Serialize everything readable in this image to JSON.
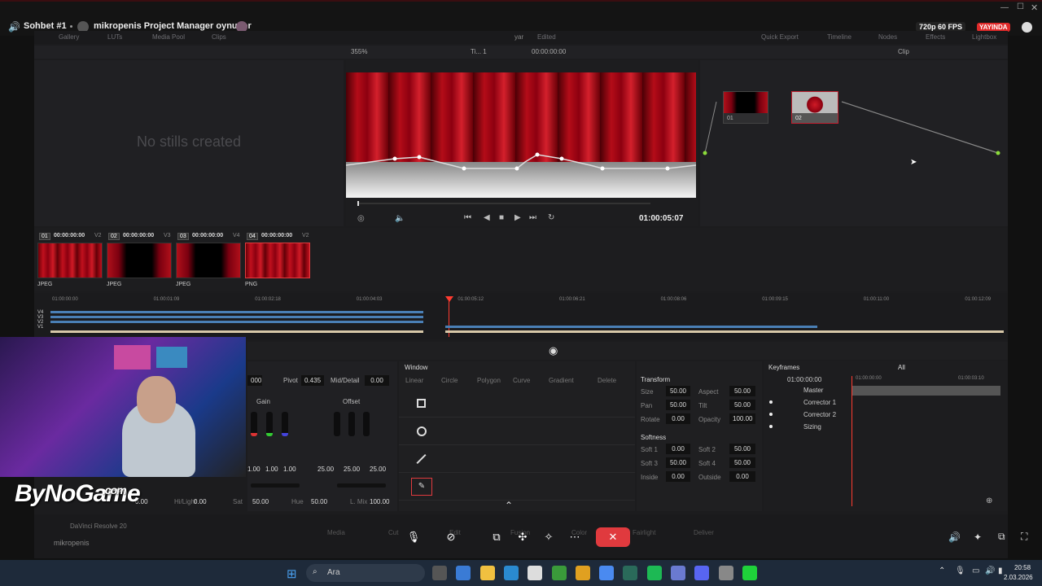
{
  "window": {
    "title": "Sohbet #1",
    "activity": "mikropenis Project Manager oynuyor",
    "quality": "720p 60 FPS",
    "live_badge": "YAYINDA"
  },
  "resolve": {
    "top_tabs": [
      "Gallery",
      "LUTs",
      "Media Pool",
      "Clips"
    ],
    "project_name": "yar",
    "project_status": "Edited",
    "right_tabs": [
      "Quick Export",
      "Timeline",
      "Nodes",
      "Effects",
      "Lightbox"
    ],
    "zoom": "355%",
    "track_select": "Ti... 1",
    "viewer_timecode_top": "00:00:00:00",
    "clip_mode": "Clip",
    "gallery_empty": "No stills created",
    "viewer_timecode": "01:00:05:07",
    "nodes": [
      {
        "label": "01"
      },
      {
        "label": "02"
      }
    ],
    "clips": [
      {
        "index": "01",
        "tc": "00:00:00:00",
        "track": "V2",
        "format": "JPEG"
      },
      {
        "index": "02",
        "tc": "00:00:00:00",
        "track": "V3",
        "format": "JPEG"
      },
      {
        "index": "03",
        "tc": "00:00:00:00",
        "track": "V4",
        "format": "JPEG"
      },
      {
        "index": "04",
        "tc": "00:00:00:00",
        "track": "V2",
        "format": "PNG"
      }
    ],
    "ruler": [
      "01:00:00:00",
      "01:00:01:09",
      "01:00:02:18",
      "01:00:04:03",
      "01:00:05:12",
      "01:00:06:21",
      "01:00:08:06",
      "01:00:09:15",
      "01:00:11:00",
      "01:00:12:09"
    ],
    "tracks": [
      "V4",
      "V3",
      "V2",
      "V1"
    ],
    "primaries": {
      "left_value": "000",
      "pivot_label": "Pivot",
      "pivot": "0.435",
      "middetail_label": "Mid/Detail",
      "middetail": "0.00",
      "gain_label": "Gain",
      "offset_label": "Offset",
      "gain_vals": [
        "1.00",
        "1.00",
        "1.00"
      ],
      "offset_vals": [
        "25.00",
        "25.00",
        "25.00"
      ],
      "bottom": [
        {
          "l": "",
          "v": "0.00"
        },
        {
          "l": "Hi/Light",
          "v": "0.00"
        },
        {
          "l": "Sat",
          "v": "50.00"
        },
        {
          "l": "Hue",
          "v": "50.00"
        },
        {
          "l": "L. Mix",
          "v": "100.00"
        }
      ]
    },
    "window_panel": {
      "title": "Window",
      "tools": [
        "Linear",
        "Circle",
        "Polygon",
        "Curve",
        "Gradient",
        "Delete"
      ]
    },
    "transform": {
      "title": "Transform",
      "rows": [
        [
          "Size",
          "50.00",
          "Aspect",
          "50.00"
        ],
        [
          "Pan",
          "50.00",
          "Tilt",
          "50.00"
        ],
        [
          "Rotate",
          "0.00",
          "Opacity",
          "100.00"
        ]
      ],
      "softness_title": "Softness",
      "soft": [
        [
          "Soft 1",
          "0.00",
          "Soft 2",
          "50.00"
        ],
        [
          "Soft 3",
          "50.00",
          "Soft 4",
          "50.00"
        ],
        [
          "Inside",
          "0.00",
          "Outside",
          "0.00"
        ]
      ]
    },
    "keyframes": {
      "title": "Keyframes",
      "filter": "All",
      "tc": "01:00:00:00",
      "ruler_a": "01:00:00:00",
      "ruler_b": "01:00:03:10",
      "rows": [
        "Master",
        "Corrector 1",
        "Corrector 2",
        "Sizing"
      ]
    },
    "app_name": "DaVinci Resolve 20",
    "pages": [
      "Media",
      "Cut",
      "Edit",
      "Fusion",
      "Color",
      "Fairlight",
      "Deliver"
    ]
  },
  "streamer": {
    "logo": "ByNoGame",
    "logo_sub": ".com",
    "user": "mikropenis"
  },
  "taskbar": {
    "search_placeholder": "Ara",
    "time": "20:58",
    "date": "2.03.2026"
  },
  "colors": {
    "accent_red": "#e03a3e",
    "playhead": "#ff3b30",
    "node_green": "#8bdc3a"
  }
}
